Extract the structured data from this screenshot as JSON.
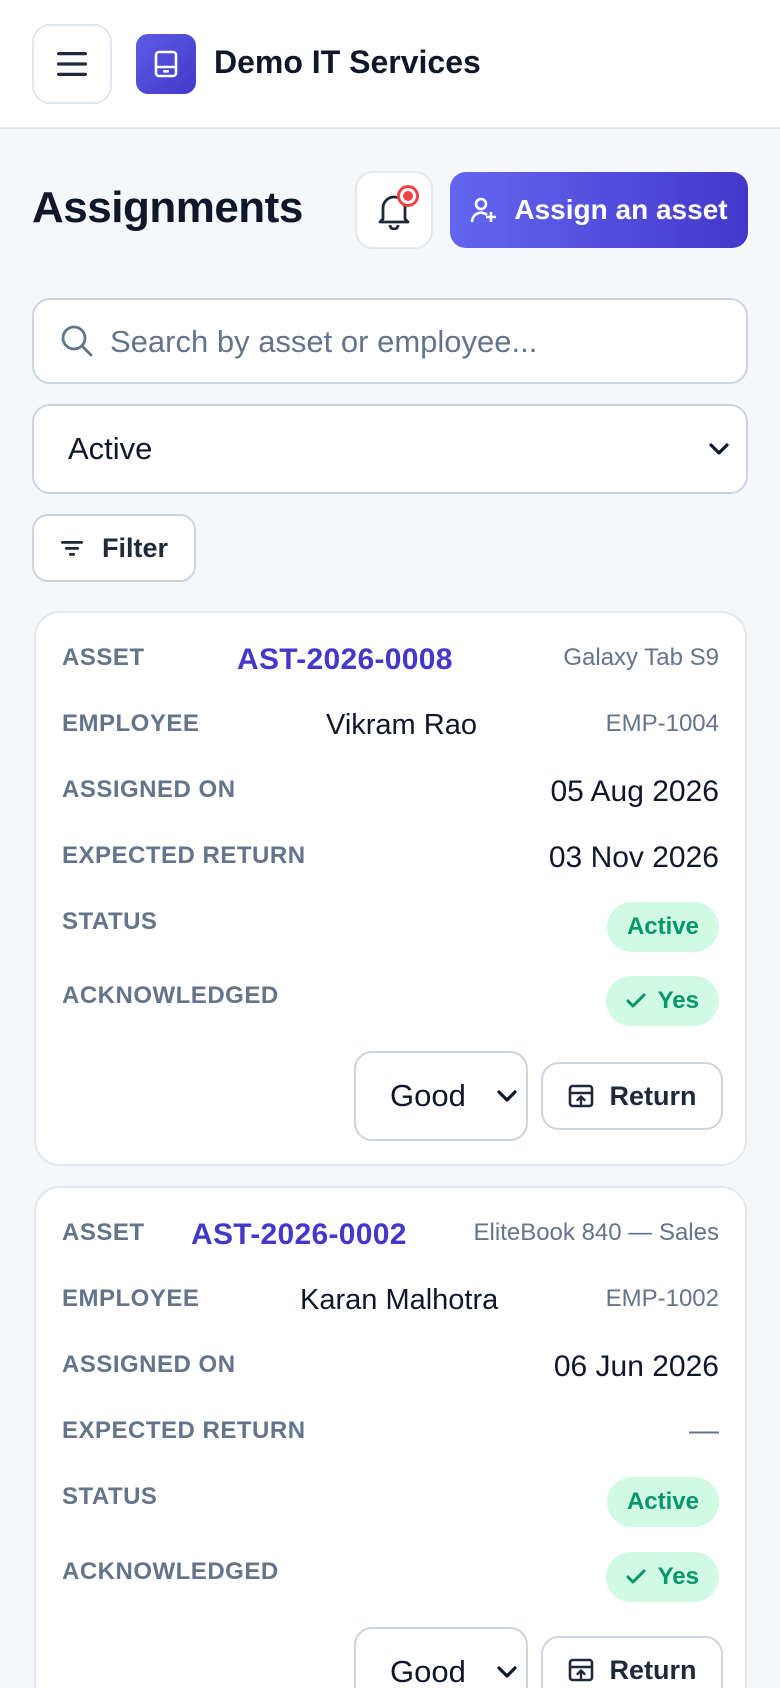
{
  "header": {
    "app_title": "Demo IT Services"
  },
  "page": {
    "title": "Assignments",
    "assign_label": "Assign an asset"
  },
  "search": {
    "placeholder": "Search by asset or employee..."
  },
  "status_filter": {
    "selected": "Active"
  },
  "filter_label": "Filter",
  "field_labels": {
    "asset": "ASSET",
    "employee": "EMPLOYEE",
    "assigned_on": "ASSIGNED ON",
    "expected_return": "EXPECTED RETURN",
    "status": "STATUS",
    "acknowledged": "ACKNOWLEDGED"
  },
  "assignments": [
    {
      "asset_code": "AST-2026-0008",
      "asset_name": "Galaxy Tab S9",
      "employee_name": "Vikram Rao",
      "employee_id": "EMP-1004",
      "assigned_on": "05 Aug 2026",
      "expected_return": "03 Nov 2026",
      "status": "Active",
      "acknowledged": "Yes",
      "condition": "Good",
      "return_label": "Return"
    },
    {
      "asset_code": "AST-2026-0002",
      "asset_name": "EliteBook 840 — Sales",
      "employee_name": "Karan Malhotra",
      "employee_id": "EMP-1002",
      "assigned_on": "06 Jun 2026",
      "expected_return": "—",
      "status": "Active",
      "acknowledged": "Yes",
      "condition": "Good",
      "return_label": "Return"
    }
  ],
  "colors": {
    "accent": "#4f46e5",
    "accent_text": "#4338ca",
    "badge_bg": "#d1fae5",
    "badge_text": "#059669",
    "notification": "#ef4444"
  },
  "icons": {
    "menu": "menu-icon",
    "logo": "laptop-icon",
    "bell": "bell-icon",
    "assign": "user-plus-icon",
    "search": "search-icon",
    "filter": "filter-icon",
    "check": "check-icon",
    "return": "archive-return-icon",
    "chevron": "chevron-down-icon"
  }
}
